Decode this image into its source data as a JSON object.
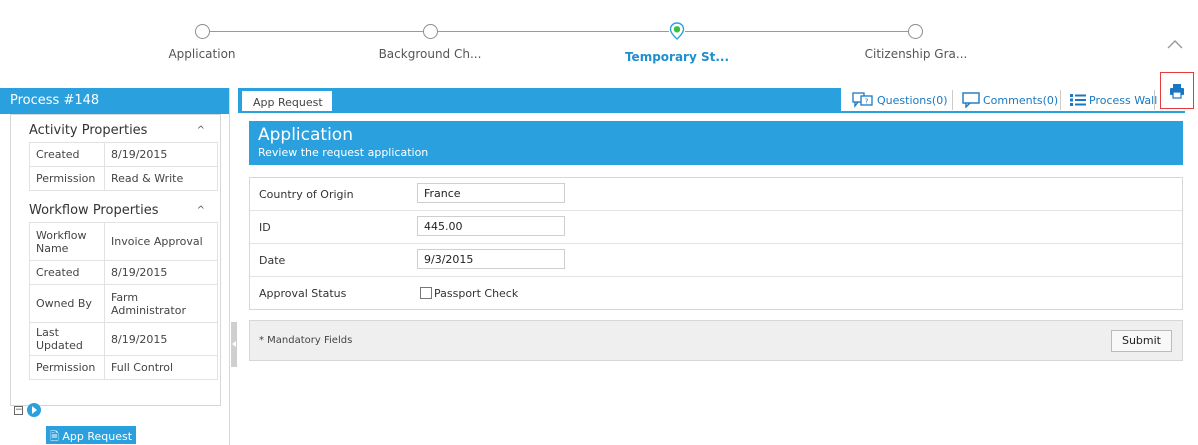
{
  "stepper": {
    "steps": [
      {
        "label": "Application",
        "state": "done"
      },
      {
        "label": "Background Ch...",
        "state": "done"
      },
      {
        "label": "Temporary St...",
        "state": "current"
      },
      {
        "label": "Citizenship Gra...",
        "state": "pending"
      }
    ],
    "collapse_icon": "chevron-up-icon"
  },
  "left_panel": {
    "title": "Process #148",
    "activity": {
      "title": "Activity Properties",
      "rows": [
        {
          "key": "Created",
          "value": "8/19/2015"
        },
        {
          "key": "Permission",
          "value": "Read & Write"
        }
      ]
    },
    "workflow": {
      "title": "Workflow Properties",
      "rows": [
        {
          "key": "Workflow Name",
          "value": "Invoice Approval"
        },
        {
          "key": "Created",
          "value": "8/19/2015"
        },
        {
          "key": "Owned By",
          "value": "Farm Administrator"
        },
        {
          "key": "Last Updated",
          "value": "8/19/2015"
        },
        {
          "key": "Permission",
          "value": "Full Control"
        }
      ]
    },
    "tree": {
      "node_label": "App Request"
    }
  },
  "tabs": {
    "active": "App Request"
  },
  "toolbar": {
    "questions": "Questions(0)",
    "comments": "Comments(0)",
    "process_wall": "Process Wall",
    "print_icon": "print-icon"
  },
  "application": {
    "title": "Application",
    "subtitle": "Review the request application"
  },
  "form": {
    "country_label": "Country of Origin",
    "country_value": "France",
    "id_label": "ID",
    "id_value": "445.00",
    "date_label": "Date",
    "date_value": "9/3/2015",
    "approval_label": "Approval Status",
    "passport_label": "Passport Check",
    "passport_checked": false
  },
  "footer": {
    "mandatory": "* Mandatory Fields",
    "submit": "Submit"
  },
  "colors": {
    "accent": "#2ba0de",
    "current_step": "#3cc13b",
    "highlight_border": "#e53b3b"
  }
}
